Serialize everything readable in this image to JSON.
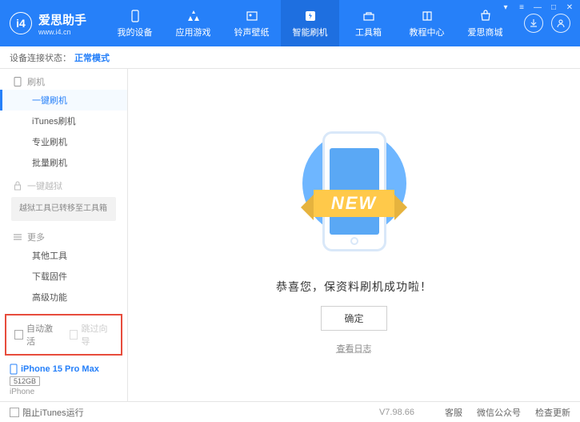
{
  "header": {
    "logo_title": "爱思助手",
    "logo_sub": "www.i4.cn",
    "logo_letter": "i4",
    "nav": [
      {
        "label": "我的设备"
      },
      {
        "label": "应用游戏"
      },
      {
        "label": "铃声壁纸"
      },
      {
        "label": "智能刷机"
      },
      {
        "label": "工具箱"
      },
      {
        "label": "教程中心"
      },
      {
        "label": "爱思商城"
      }
    ]
  },
  "status": {
    "label": "设备连接状态：",
    "mode": "正常模式"
  },
  "sidebar": {
    "section_flash": "刷机",
    "items_flash": [
      "一键刷机",
      "iTunes刷机",
      "专业刷机",
      "批量刷机"
    ],
    "section_jail": "一键越狱",
    "jail_note": "越狱工具已转移至工具箱",
    "section_more": "更多",
    "items_more": [
      "其他工具",
      "下载固件",
      "高级功能"
    ],
    "auto_activate": "自动激活",
    "skip_guide": "跳过向导"
  },
  "device": {
    "name": "iPhone 15 Pro Max",
    "storage": "512GB",
    "type": "iPhone"
  },
  "main": {
    "ribbon": "NEW",
    "success": "恭喜您，保资料刷机成功啦！",
    "ok": "确定",
    "view_log": "查看日志"
  },
  "footer": {
    "block_itunes": "阻止iTunes运行",
    "version": "V7.98.66",
    "links": [
      "客服",
      "微信公众号",
      "检查更新"
    ]
  }
}
